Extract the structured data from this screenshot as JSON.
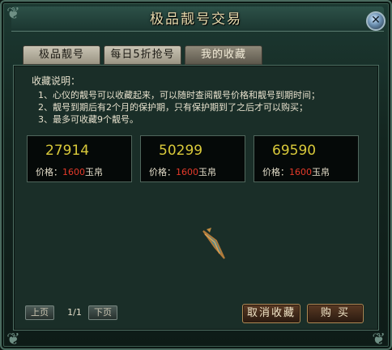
{
  "window": {
    "title": "极品靓号交易",
    "close_label": "✕"
  },
  "tabs": [
    {
      "label": "极品靓号",
      "active": false
    },
    {
      "label": "每日5折抢号",
      "active": false
    },
    {
      "label": "我的收藏",
      "active": true
    }
  ],
  "notes": {
    "heading": "收藏说明：",
    "lines": [
      "1、心仪的靓号可以收藏起来，可以随时查阅靓号价格和靓号到期时间；",
      "2、靓号到期后有2个月的保护期，只有保护期到了之后才可以购买；",
      "3、最多可收藏9个靓号。"
    ]
  },
  "favorites": [
    {
      "number": "27914",
      "price_label": "价格：",
      "price": "1600",
      "currency": "玉帛"
    },
    {
      "number": "50299",
      "price_label": "价格：",
      "price": "1600",
      "currency": "玉帛"
    },
    {
      "number": "69590",
      "price_label": "价格：",
      "price": "1600",
      "currency": "玉帛"
    }
  ],
  "pagination": {
    "prev_label": "上页",
    "page": "1/1",
    "next_label": "下页"
  },
  "actions": {
    "unfavorite_label": "取消收藏",
    "buy_label": "购 买"
  },
  "colors": {
    "number": "#d9c93a",
    "price": "#e63a2a",
    "text": "#e6e0cc"
  }
}
